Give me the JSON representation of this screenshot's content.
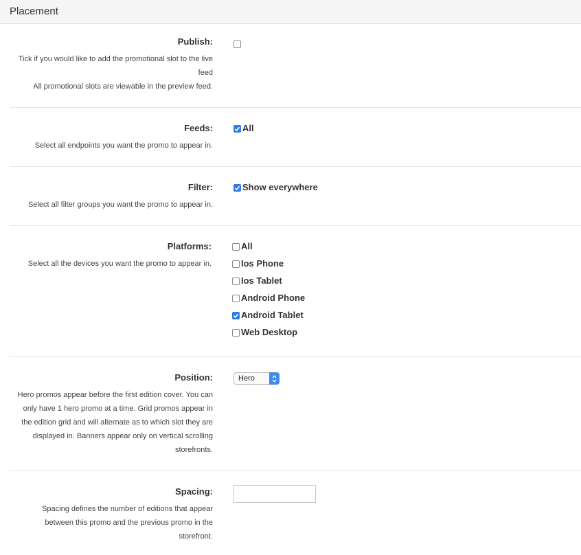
{
  "header": {
    "title": "Placement"
  },
  "publish": {
    "label": "Publish:",
    "help_line1": "Tick if you would like to add the promotional slot to the live",
    "help_line2": "feed",
    "help_line3": "All promotional slots are viewable in the preview feed.",
    "checked": false
  },
  "feeds": {
    "label": "Feeds:",
    "help": "Select all endpoints you want the promo to appear in.",
    "options": [
      {
        "label": "All",
        "checked": true
      }
    ]
  },
  "filter": {
    "label": "Filter:",
    "help": "Select all filter groups you want the promo to appear in.",
    "options": [
      {
        "label": "Show everywhere",
        "checked": true
      }
    ]
  },
  "platforms": {
    "label": "Platforms:",
    "help": "Select all the devices you want the promo to appear in.",
    "options": [
      {
        "label": "All",
        "checked": false
      },
      {
        "label": "Ios Phone",
        "checked": false
      },
      {
        "label": "Ios Tablet",
        "checked": false
      },
      {
        "label": "Android Phone",
        "checked": false
      },
      {
        "label": "Android Tablet",
        "checked": true
      },
      {
        "label": "Web Desktop",
        "checked": false
      }
    ]
  },
  "position": {
    "label": "Position:",
    "help_lines": [
      "Hero promos appear before the first edition cover. You can",
      "only have 1 hero promo at a time. Grid promos appear in",
      "the edition grid and will alternate as to which slot they are",
      "displayed in. Banners appear only on vertical scrolling",
      "storefronts."
    ],
    "selected": "Hero"
  },
  "spacing": {
    "label": "Spacing:",
    "help_lines": [
      "Spacing defines the number of editions that appear",
      "between this promo and the previous promo in the",
      "storefront."
    ],
    "value": ""
  },
  "colors": {
    "checkbox_checked": "#2f7ce4",
    "select_arrow": "#3d8bec"
  },
  "icons": {
    "check": "checkmark-icon",
    "select": "select-arrows-icon"
  }
}
